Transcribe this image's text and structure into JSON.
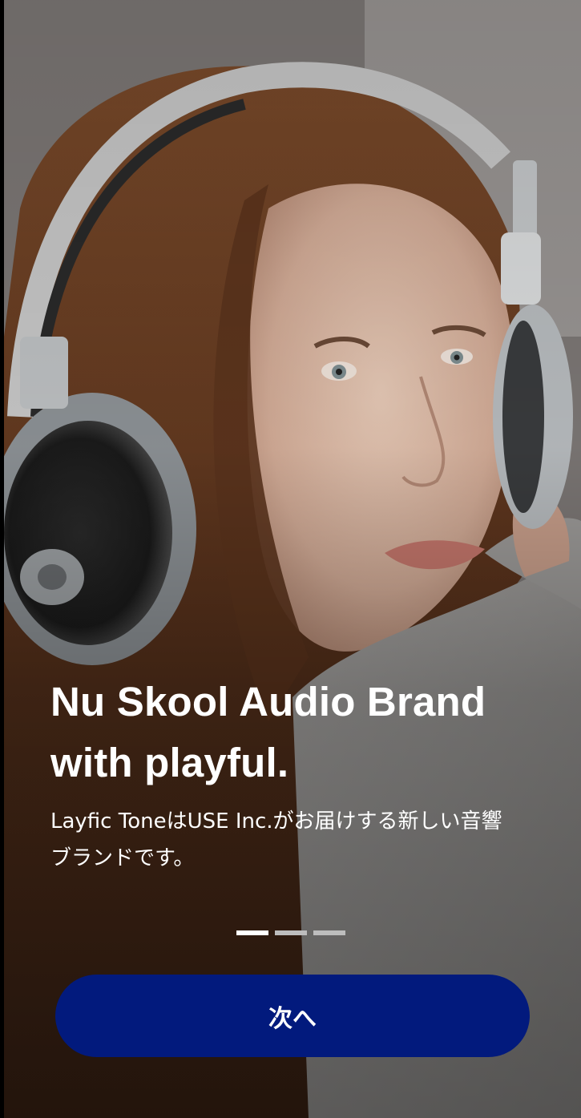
{
  "onboarding": {
    "headline_line1": "Nu Skool Audio Brand",
    "headline_line2": "with playful.",
    "description_line1": "Layfic ToneはUSE Inc.がお届けする新しい音響",
    "description_line2": "ブランドです。",
    "pager": {
      "total_pages": 3,
      "current_page": 1
    },
    "next_button_label": "次へ"
  },
  "colors": {
    "button_background": "#021a7d",
    "text": "#ffffff",
    "pager_active": "#ffffff",
    "pager_inactive": "#bdbdbd"
  },
  "hero_image": {
    "icon": "woman-with-headphones-photo"
  }
}
